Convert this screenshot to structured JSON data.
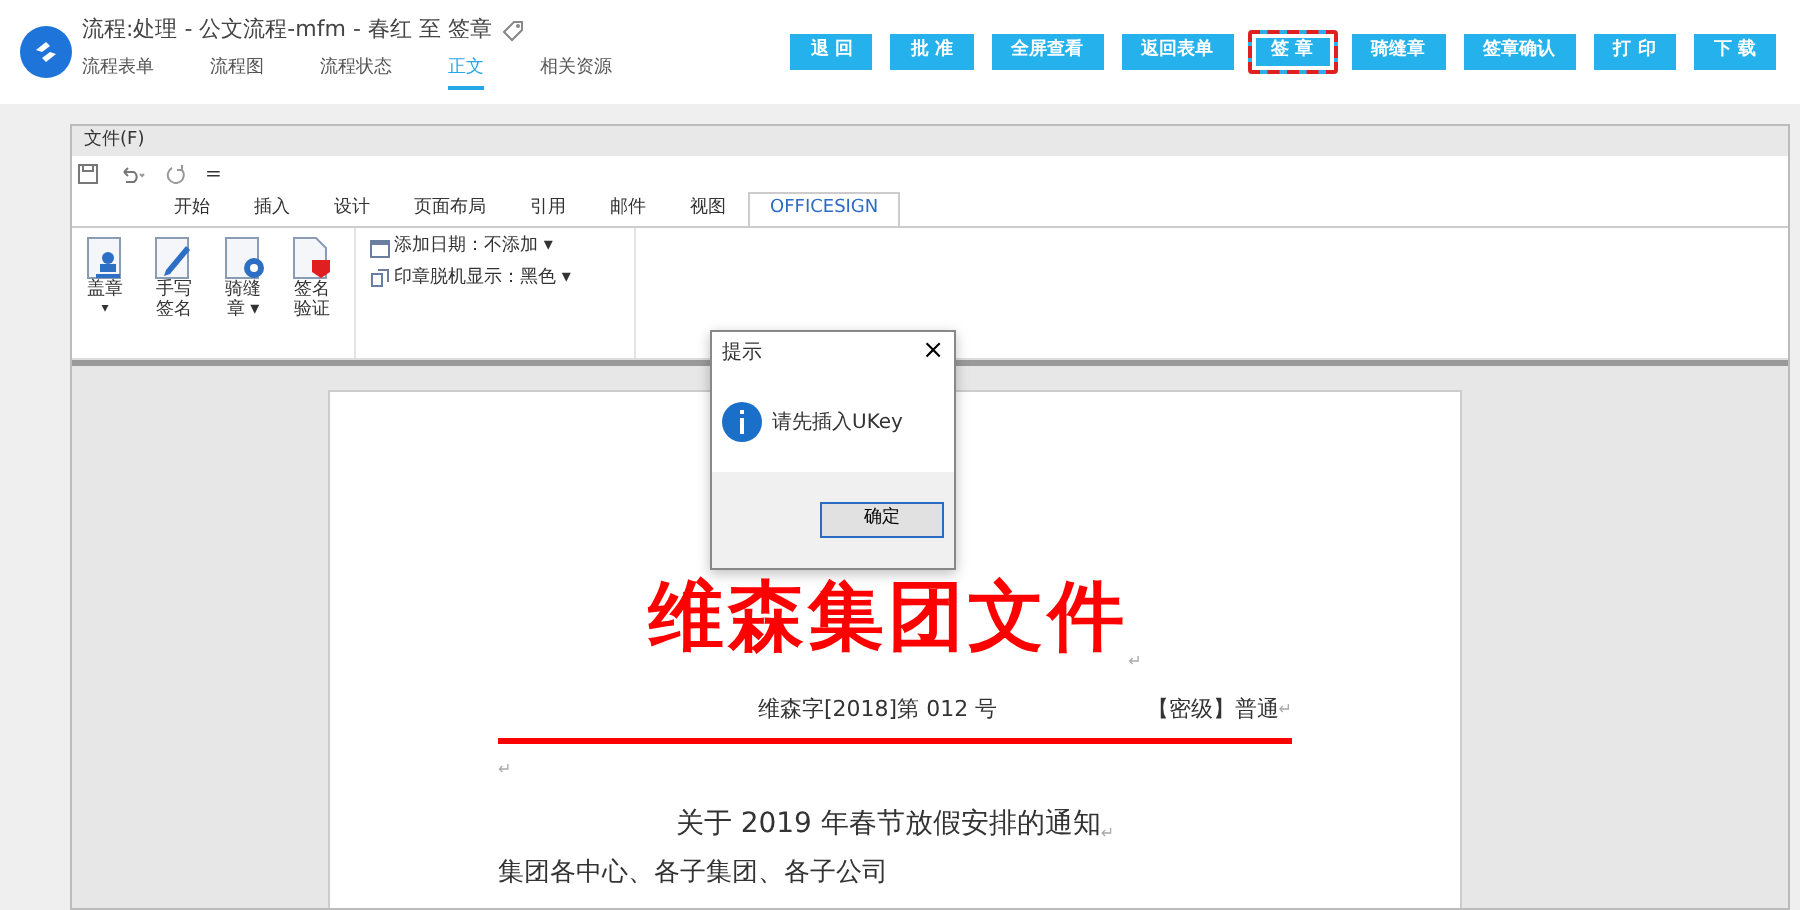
{
  "header": {
    "title": "流程:处理 - 公文流程-mfm - 春红 至 签章",
    "tabs": [
      {
        "label": "流程表单",
        "selected": false
      },
      {
        "label": "流程图",
        "selected": false
      },
      {
        "label": "流程状态",
        "selected": false
      },
      {
        "label": "正文",
        "selected": true
      },
      {
        "label": "相关资源",
        "selected": false
      }
    ],
    "buttons": [
      {
        "label": "退 回",
        "highlighted": false
      },
      {
        "label": "批 准",
        "highlighted": false
      },
      {
        "label": "全屏查看",
        "highlighted": false
      },
      {
        "label": "返回表单",
        "highlighted": false
      },
      {
        "label": "签 章",
        "highlighted": true
      },
      {
        "label": "骑缝章",
        "highlighted": false
      },
      {
        "label": "签章确认",
        "highlighted": false
      },
      {
        "label": "打 印",
        "highlighted": false
      },
      {
        "label": "下 载",
        "highlighted": false
      }
    ]
  },
  "editor": {
    "menu": "文件(F)",
    "quick_access": {
      "more": "="
    },
    "ribbon_tabs": [
      {
        "label": "开始",
        "selected": false
      },
      {
        "label": "插入",
        "selected": false
      },
      {
        "label": "设计",
        "selected": false
      },
      {
        "label": "页面布局",
        "selected": false
      },
      {
        "label": "引用",
        "selected": false
      },
      {
        "label": "邮件",
        "selected": false
      },
      {
        "label": "视图",
        "selected": false
      },
      {
        "label": "OFFICESIGN",
        "selected": true
      }
    ],
    "large_buttons": [
      {
        "kind": "stamp",
        "lines": [
          "盖章"
        ],
        "caret": "▾"
      },
      {
        "kind": "handwrite",
        "lines": [
          "手写",
          "签名"
        ]
      },
      {
        "kind": "seam",
        "lines": [
          "骑缝",
          "章"
        ],
        "caret": "▾"
      },
      {
        "kind": "verify",
        "lines": [
          "签名",
          "验证"
        ]
      }
    ],
    "small_buttons": [
      {
        "kind": "date",
        "label": "添加日期：不添加",
        "caret": "▾"
      },
      {
        "kind": "display",
        "label": "印章脱机显示：黑色",
        "caret": "▾"
      }
    ],
    "document": {
      "mark": "↵",
      "paragraphs": [
        {
          "kind": "masthead",
          "text": "维森集团文件"
        },
        {
          "kind": "docno",
          "text": "维森字[2018]第 012 号",
          "right": "【密级】普通"
        },
        {
          "kind": "rule"
        },
        {
          "kind": "empty"
        },
        {
          "kind": "title",
          "text": "关于 2019 年春节放假安排的通知"
        },
        {
          "kind": "body",
          "text": "集团各中心、各子集团、各子公司"
        }
      ]
    }
  },
  "dialog": {
    "title": "提示",
    "close": "×",
    "message": "请先插入UKey",
    "button": "确定"
  }
}
